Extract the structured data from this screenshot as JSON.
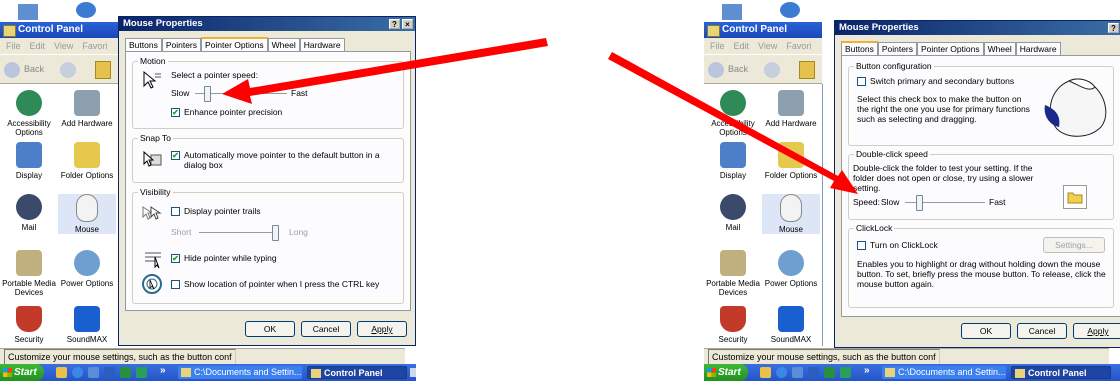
{
  "control_panel": {
    "title": "Control Panel",
    "menu": [
      "File",
      "Edit",
      "View",
      "Favori"
    ],
    "toolbar": {
      "back_label": "Back"
    },
    "icons": [
      {
        "label": "Accessibility Options",
        "icon": "accessibility-icon"
      },
      {
        "label": "Add Hardware",
        "icon": "add-hardware-icon"
      },
      {
        "label": "Display",
        "icon": "display-icon"
      },
      {
        "label": "Folder Options",
        "icon": "folder-options-icon"
      },
      {
        "label": "Mail",
        "icon": "mail-icon"
      },
      {
        "label": "Mouse",
        "icon": "mouse-icon"
      },
      {
        "label": "Portable Media Devices",
        "icon": "portable-media-icon"
      },
      {
        "label": "Power Options",
        "icon": "power-options-icon"
      },
      {
        "label": "Security",
        "icon": "security-icon"
      },
      {
        "label": "SoundMAX",
        "icon": "soundmax-icon"
      }
    ],
    "status": "Customize your mouse settings, such as the button conf"
  },
  "taskbar": {
    "start_label": "Start",
    "chevron": "»",
    "task_explorer": "C:\\Documents and Settin...",
    "task_control_panel": "Control Panel"
  },
  "dialog": {
    "title": "Mouse Properties",
    "help_glyph": "?",
    "close_glyph": "×",
    "tabs": [
      "Buttons",
      "Pointers",
      "Pointer Options",
      "Wheel",
      "Hardware"
    ],
    "buttons": {
      "ok": "OK",
      "cancel": "Cancel",
      "apply": "Apply",
      "settings": "Settings..."
    }
  },
  "pointer_options": {
    "motion_group": "Motion",
    "select_speed": "Select a pointer speed:",
    "slow": "Slow",
    "fast": "Fast",
    "enhance_precision": "Enhance pointer precision",
    "snap_to_group": "Snap To",
    "snap_to_text": "Automatically move pointer to the default button in a dialog box",
    "visibility_group": "Visibility",
    "display_trails": "Display pointer trails",
    "short": "Short",
    "long": "Long",
    "hide_while_typing": "Hide pointer while typing",
    "show_location": "Show location of pointer when I press the CTRL key"
  },
  "buttons_tab": {
    "button_config_group": "Button configuration",
    "switch_buttons": "Switch primary and secondary buttons",
    "switch_desc": "Select this check box to make the button on the right the one you use for primary functions such as selecting and dragging.",
    "double_click_group": "Double-click speed",
    "double_click_desc": "Double-click the folder to test your setting. If the folder does not open or close, try using a slower setting.",
    "speed": "Speed:",
    "slow": "Slow",
    "fast": "Fast",
    "clicklock_group": "ClickLock",
    "turn_on_clicklock": "Turn on ClickLock",
    "clicklock_desc": "Enables you to highlight or drag without holding down the mouse button. To set, briefly press the mouse button. To release, click the mouse button again."
  },
  "state": {
    "pointer_speed_fraction": 0.1,
    "trail_length_fraction": 1.0,
    "double_click_speed_fraction": 0.15,
    "enhance_checked": true,
    "snap_checked": true,
    "trails_checked": false,
    "hide_checked": true,
    "show_location_checked": false,
    "switch_checked": false,
    "clicklock_checked": false
  },
  "colors": {
    "title_bar": "#0a246a",
    "dialog_face": "#ece9d8",
    "annotation_arrow": "#ff0000",
    "start_button": "#3db83a"
  }
}
